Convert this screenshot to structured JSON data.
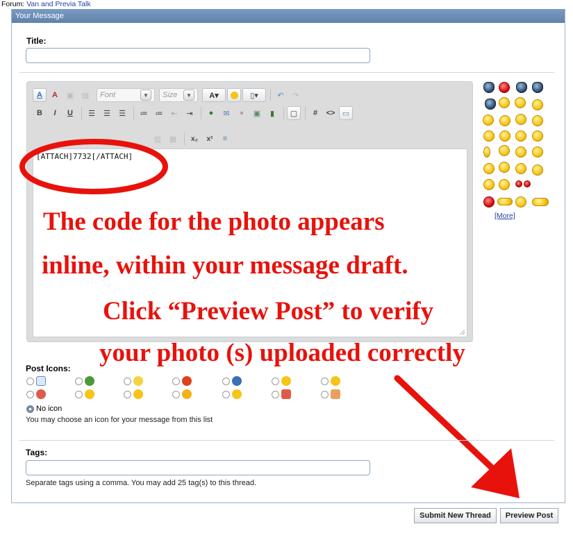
{
  "breadcrumb": {
    "prefix": "Forum:",
    "forum_name": "Van and Previa Talk"
  },
  "panel": {
    "title": "Your Message"
  },
  "title_field": {
    "label": "Title:",
    "value": ""
  },
  "toolbar": {
    "font_select": "Font",
    "size_select": "Size",
    "bold": "B",
    "italic": "I",
    "underline": "U",
    "hash": "#",
    "code": "<>",
    "subscript": "x₂",
    "superscript": "x²"
  },
  "editor": {
    "content": "[ATTACH]7732[/ATTACH]"
  },
  "smilies": {
    "more_label": "[More]"
  },
  "annotations": {
    "line1": "The code for the photo appears",
    "line2": "inline, within your message draft.",
    "line3": "Click “Preview Post” to verify",
    "line4": "your photo (s) uploaded correctly",
    "accent_color": "#e8120c"
  },
  "post_icons": {
    "label": "Post Icons:",
    "no_icon_label": "No icon",
    "help_text": "You may choose an icon for your message from this list",
    "selected": "No icon"
  },
  "tags": {
    "label": "Tags:",
    "value": "",
    "help_text": "Separate tags using a comma. You may add 25 tag(s) to this thread."
  },
  "actions": {
    "submit_label": "Submit New Thread",
    "preview_label": "Preview Post"
  }
}
